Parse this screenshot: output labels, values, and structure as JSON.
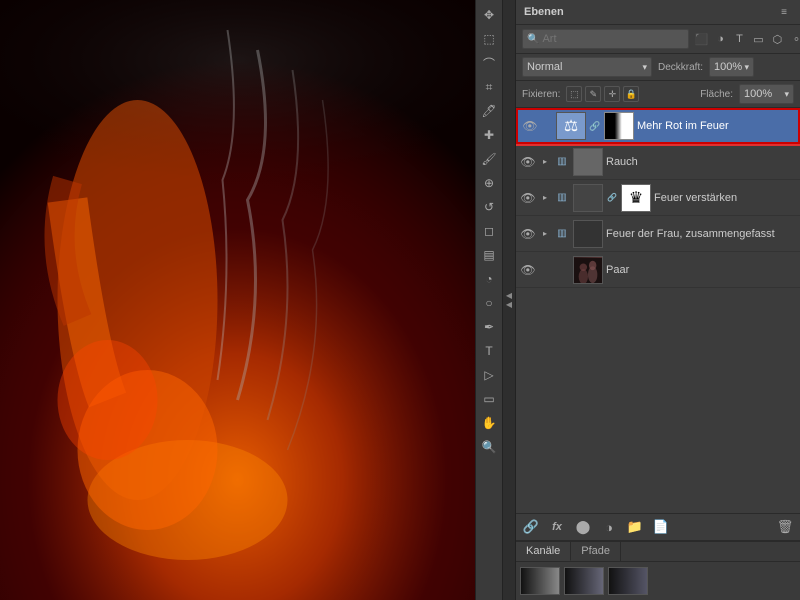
{
  "panel": {
    "title": "Ebenen",
    "search_placeholder": "Art",
    "collapse_icon": "◀",
    "settings_icon": "≡"
  },
  "blend_mode": {
    "label": "Normal",
    "opacity_label": "Deckkraft:",
    "opacity_value": "100%",
    "lock_label": "Fixieren:",
    "flaeche_label": "Fläche:",
    "flaeche_value": "100%"
  },
  "layers": [
    {
      "id": "mehr-rot",
      "name": "Mehr Rot im Feuer",
      "visible": true,
      "type": "adjustment",
      "selected": true,
      "has_mask": true,
      "has_chain": true,
      "expandable": false
    },
    {
      "id": "rauch",
      "name": "Rauch",
      "visible": true,
      "type": "folder",
      "selected": false,
      "has_mask": false,
      "expandable": true
    },
    {
      "id": "feuer-verst",
      "name": "Feuer verstärken",
      "visible": true,
      "type": "folder",
      "selected": false,
      "has_mask": true,
      "expandable": true
    },
    {
      "id": "feuer-der-frau",
      "name": "Feuer der Frau, zusammengefasst",
      "visible": true,
      "type": "folder",
      "selected": false,
      "has_mask": false,
      "expandable": true
    },
    {
      "id": "paar",
      "name": "Paar",
      "visible": true,
      "type": "image",
      "selected": false,
      "has_mask": false,
      "expandable": false
    }
  ],
  "bottom_toolbar": {
    "link_icon": "🔗",
    "fx_icon": "fx",
    "mask_icon": "⬤",
    "adjustment_icon": "◑",
    "folder_icon": "📁",
    "delete_icon": "🗑"
  },
  "bottom_tabs": {
    "tabs": [
      "Kanäle",
      "Pfade"
    ],
    "active_tab": "Kanäle"
  },
  "icons": {
    "eye": "👁",
    "lock_transparent": "⬚",
    "lock_image": "✎",
    "lock_position": "✛",
    "lock_all": "🔒",
    "search": "🔍"
  }
}
